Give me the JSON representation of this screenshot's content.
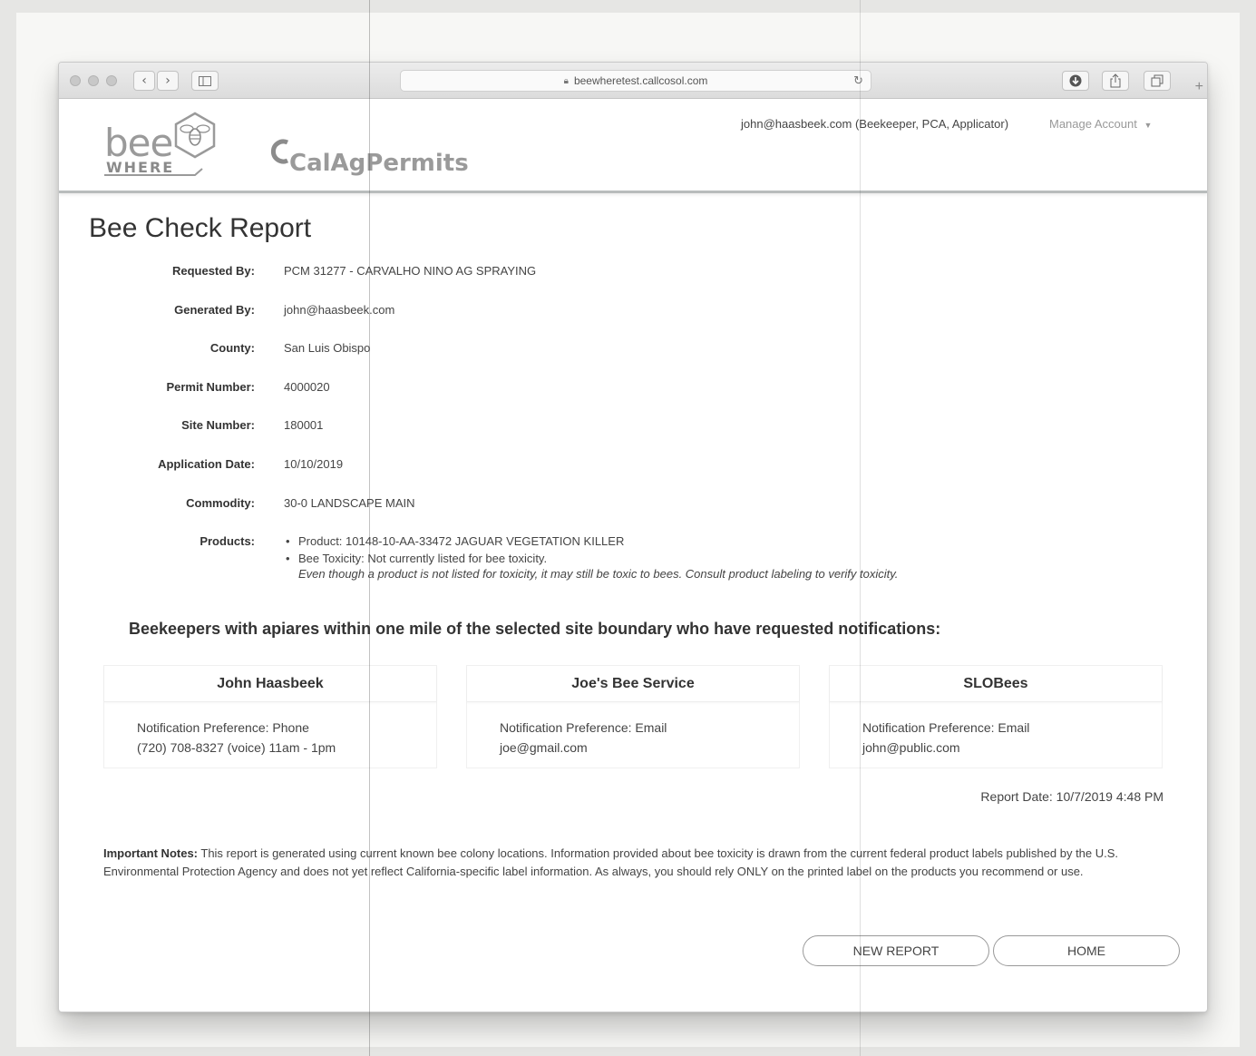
{
  "browser": {
    "url": "beewheretest.callcosol.com"
  },
  "header": {
    "bee_logo_top": "bee",
    "bee_logo_bottom": "WHERE",
    "calag_logo": "CalAgPermits",
    "user_email": "john@haasbeek.com (Beekeeper, PCA, Applicator)",
    "manage_account": "Manage Account"
  },
  "report": {
    "title": "Bee Check Report",
    "fields": [
      {
        "label": "Requested By:",
        "value": "PCM 31277 - CARVALHO NINO AG SPRAYING"
      },
      {
        "label": "Generated By:",
        "value": "john@haasbeek.com"
      },
      {
        "label": "County:",
        "value": "San Luis Obispo"
      },
      {
        "label": "Permit Number:",
        "value": "4000020"
      },
      {
        "label": "Site Number:",
        "value": "180001"
      },
      {
        "label": "Application Date:",
        "value": "10/10/2019"
      },
      {
        "label": "Commodity:",
        "value": "30-0 LANDSCAPE MAIN"
      }
    ],
    "products_label": "Products:",
    "products": {
      "product": "Product: 10148-10-AA-33472 JAGUAR VEGETATION KILLER",
      "toxicity": "Bee Toxicity: Not currently listed for bee toxicity.",
      "note": "Even though a product is not listed for toxicity, it may still be toxic to bees. Consult product labeling to verify toxicity."
    }
  },
  "beekeepers": {
    "heading": "Beekeepers with apiares within one mile of the selected site boundary who have requested notifications:",
    "cards": [
      {
        "name": "John Haasbeek",
        "preference": "Notification Preference: Phone",
        "contact": "(720) 708-8327 (voice) 11am - 1pm"
      },
      {
        "name": "Joe's Bee Service",
        "preference": "Notification Preference: Email",
        "contact": "joe@gmail.com"
      },
      {
        "name": "SLOBees",
        "preference": "Notification Preference: Email",
        "contact": "john@public.com"
      }
    ]
  },
  "report_date": "Report Date: 10/7/2019 4:48 PM",
  "notes": {
    "label": "Important Notes:",
    "text": " This report is generated using current known bee colony locations. Information provided about bee toxicity is drawn from the current federal product labels published by the U.S. Environmental Protection Agency and does not yet reflect California-specific label information. As always, you should rely ONLY on the printed label on the products you recommend or use."
  },
  "buttons": {
    "new_report": "NEW REPORT",
    "home": "HOME"
  },
  "icons": {
    "back": "chevron-left-icon",
    "forward": "chevron-right-icon",
    "sidebar": "sidebar-icon",
    "lock": "lock-icon",
    "reload": "reload-icon",
    "download": "download-icon",
    "share": "share-icon",
    "tabs": "tabs-icon",
    "manage_caret": "caret-down-icon"
  }
}
